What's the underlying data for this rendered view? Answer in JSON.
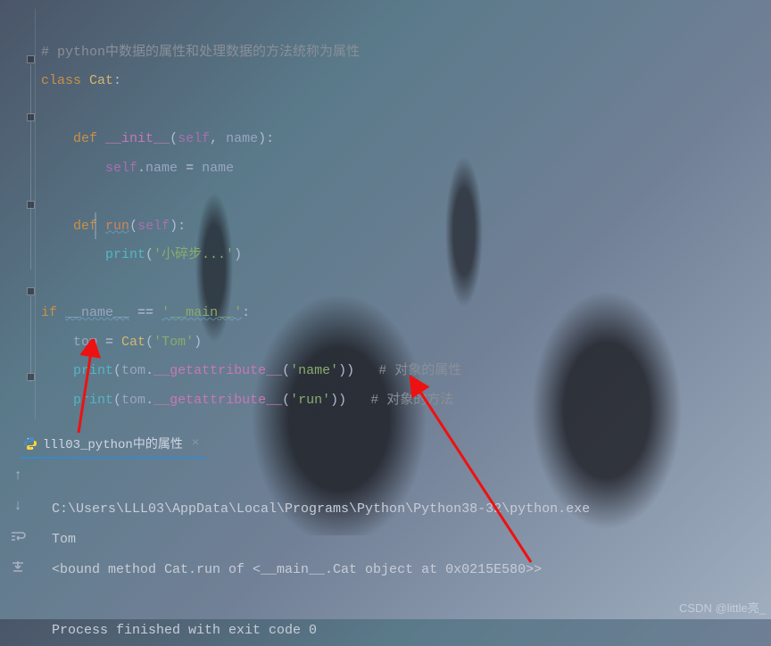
{
  "code": {
    "comment1": "# python中数据的属性和处理数据的方法统称为属性",
    "kw_class": "class",
    "cls_cat": "Cat",
    "colon": ":",
    "kw_def": "def",
    "dunder_init": "__init__",
    "open_p": "(",
    "close_p": ")",
    "self_id": "self",
    "comma_sp": ", ",
    "param_name": "name",
    "self_name": "self",
    "dot": ".",
    "attr_name": "name",
    "op_eq": " = ",
    "rhs_name": "name",
    "method_run": "run",
    "run_param_self": "self",
    "print_fn": "print",
    "str_run": "'小碎步...'",
    "kw_if": "if",
    "dunder_name": "__name__",
    "op_eqeq": " == ",
    "str_main": "'__main__'",
    "var_tom": "tom",
    "cat_call": "Cat",
    "str_tom": "'Tom'",
    "getattr": "__getattribute__",
    "str_name_arg": "'name'",
    "str_run_arg": "'run'",
    "cm_obj_attr": "# 对象的属性",
    "cm_obj_method": "# 对象的方法"
  },
  "tab": {
    "label": "lll03_python中的属性"
  },
  "output": {
    "line1": "C:\\Users\\LLL03\\AppData\\Local\\Programs\\Python\\Python38-32\\python.exe",
    "line2": "Tom",
    "line3": "<bound method Cat.run of <__main__.Cat object at 0x0215E580>>",
    "line4": "",
    "line5": "Process finished with exit code 0"
  },
  "watermark": "CSDN @little亮_"
}
